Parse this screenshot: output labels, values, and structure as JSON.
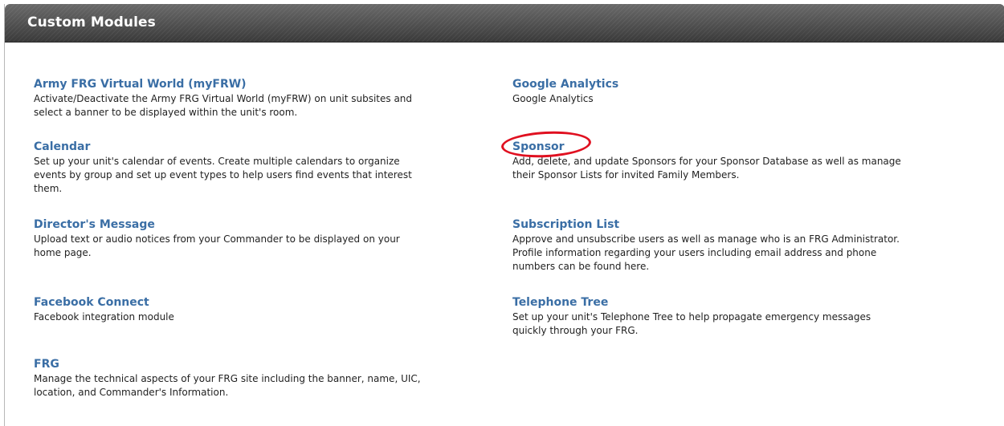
{
  "panel": {
    "title": "Custom Modules"
  },
  "left_modules": [
    {
      "title": "Army FRG Virtual World (myFRW)",
      "desc_lines": [
        "Activate/Deactivate the Army FRG Virtual World (myFRW) on unit subsites and",
        "select a banner to be displayed within the unit's room."
      ]
    },
    {
      "title": "Calendar",
      "desc_lines": [
        "Set up your unit's calendar of events. Create multiple calendars to organize",
        "events by group and set up event types to help users find events that interest",
        "them."
      ]
    },
    {
      "title": "Director's Message",
      "desc_lines": [
        "Upload text or audio notices from your Commander to be displayed on your",
        "home page."
      ]
    },
    {
      "title": "Facebook Connect",
      "desc_lines": [
        "Facebook integration module"
      ]
    },
    {
      "title": "FRG",
      "desc_lines": [
        "Manage the technical aspects of your FRG site including the banner, name, UIC,",
        "location, and Commander's Information."
      ]
    }
  ],
  "right_modules": [
    {
      "title": "Google Analytics",
      "desc_lines": [
        "Google Analytics"
      ]
    },
    {
      "title": "Sponsor",
      "desc_lines": [
        "Add, delete, and update Sponsors for your Sponsor Database as well as manage",
        "their Sponsor Lists for invited Family Members."
      ]
    },
    {
      "title": "Subscription List",
      "desc_lines": [
        "Approve and unsubscribe users as well as manage who is an FRG Administrator.",
        "Profile information regarding your users including email address and phone",
        "numbers can be found here."
      ]
    },
    {
      "title": "Telephone Tree",
      "desc_lines": [
        "Set up your unit's Telephone Tree to help propagate emergency messages",
        "quickly through your FRG."
      ]
    }
  ],
  "annotation": {
    "color": "#e01020",
    "target": "Sponsor"
  },
  "colors": {
    "link": "#3a6ea5",
    "text": "#222222",
    "header_bg": "#505050"
  }
}
